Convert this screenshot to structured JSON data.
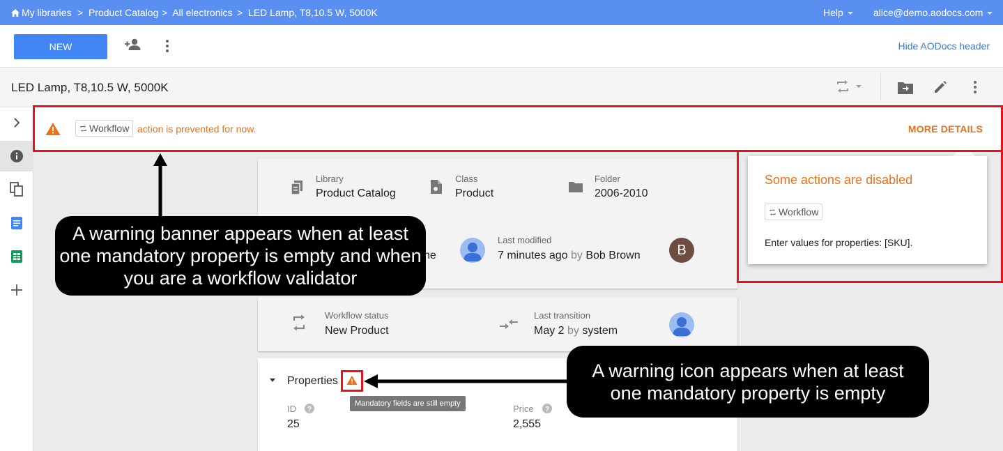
{
  "breadcrumbs": {
    "home": "My libraries",
    "library": "Product Catalog",
    "category": "All electronics",
    "document": "LED Lamp, T8,10.5 W, 5000K"
  },
  "topbar": {
    "help": "Help",
    "user": "alice@demo.aodocs.com"
  },
  "toolbar": {
    "new_label": "NEW",
    "hide_header": "Hide AODocs header"
  },
  "document": {
    "title": "LED Lamp, T8,10.5 W, 5000K"
  },
  "banner": {
    "chip_label": "Workflow",
    "message": "action is prevented for now.",
    "more_details": "MORE DETAILS"
  },
  "info_card": {
    "library_label": "Library",
    "library_value": "Product Catalog",
    "class_label": "Class",
    "class_value": "Product",
    "folder_label": "Folder",
    "folder_value": "2006-2010",
    "owner_partial": "ne",
    "modified_label": "Last modified",
    "modified_when": "7 minutes ago",
    "modified_by_word": "by",
    "modified_by": "Bob Brown",
    "modifier_initial": "B"
  },
  "workflow_card": {
    "status_label": "Workflow status",
    "status_value": "New Product",
    "transition_label": "Last transition",
    "transition_when": "May 2",
    "transition_by_word": "by",
    "transition_by": "system"
  },
  "properties": {
    "title": "Properties",
    "tooltip": "Mandatory fields are still empty",
    "fields": [
      {
        "label": "ID",
        "value": "25"
      },
      {
        "label": "Price",
        "value": "2,555"
      }
    ]
  },
  "popup": {
    "title": "Some actions are disabled",
    "chip_label": "Workflow",
    "message": "Enter values for properties: [SKU]."
  },
  "callouts": {
    "banner": "A warning banner appears when at least one mandatory property is empty and when you are a workflow validator",
    "icon": "A warning icon appears when at least one mandatory property is empty"
  },
  "colors": {
    "accent": "#4285f4",
    "topbar": "#5a8ff2",
    "warning": "#e8711c",
    "highlight": "#e5141b"
  }
}
